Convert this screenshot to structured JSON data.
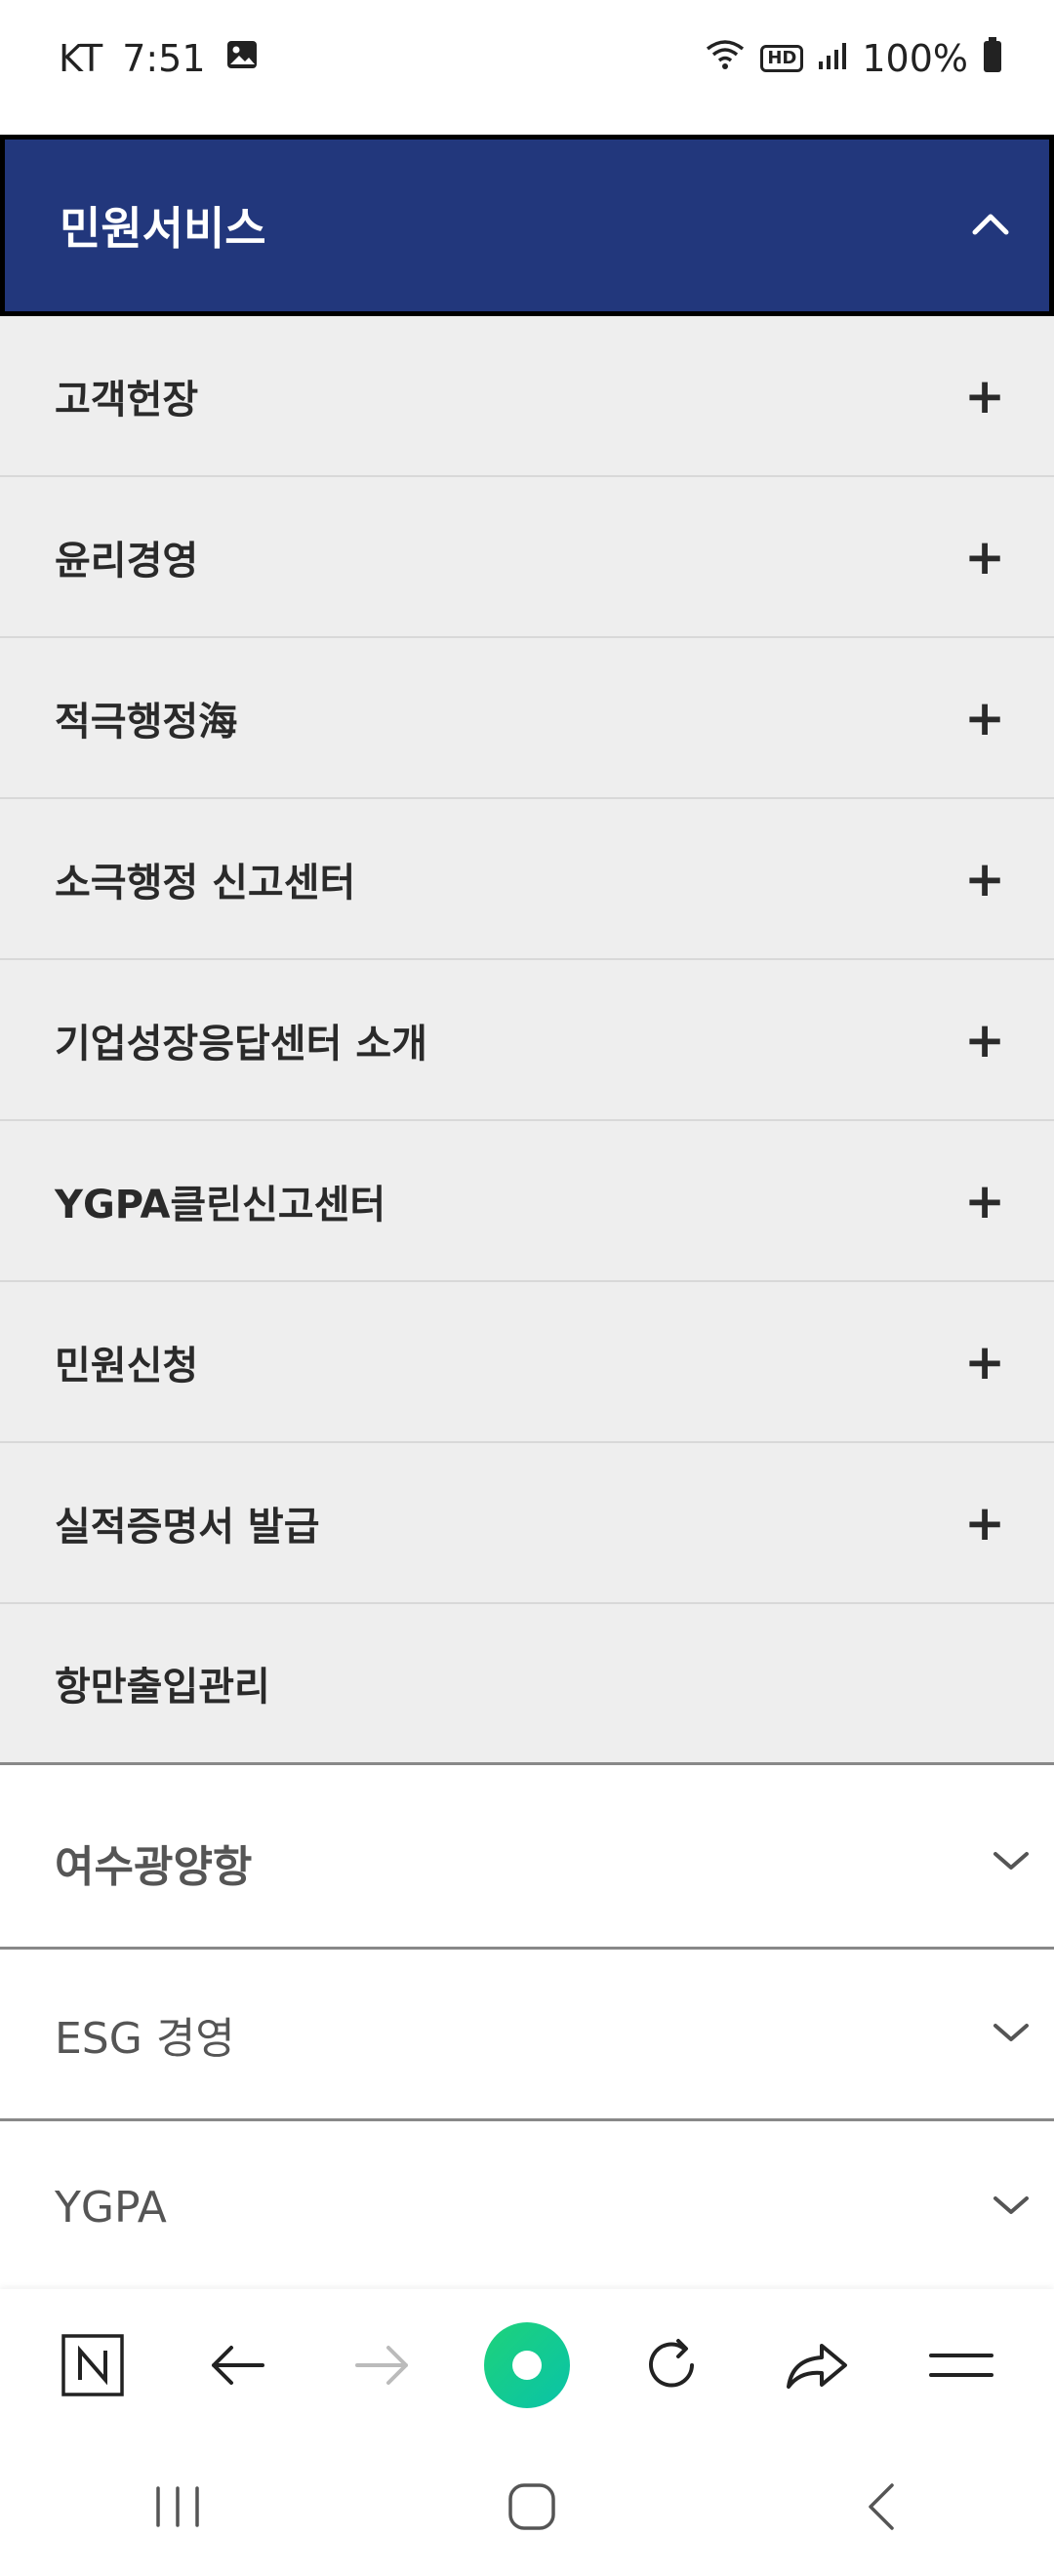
{
  "status_bar": {
    "carrier": "KT",
    "time": "7:51",
    "hd_badge": "HD",
    "battery": "100%"
  },
  "section": {
    "title": "민원서비스"
  },
  "menu_items": [
    {
      "label": "고객헌장"
    },
    {
      "label": "윤리경영"
    },
    {
      "label": "적극행정海"
    },
    {
      "label": "소극행정 신고센터"
    },
    {
      "label": "기업성장응답센터 소개"
    },
    {
      "label": "YGPA클린신고센터"
    },
    {
      "label": "민원신청"
    },
    {
      "label": "실적증명서 발급"
    },
    {
      "label": "항만출입관리"
    }
  ],
  "collapsed_sections": [
    {
      "label": "여수광양항"
    },
    {
      "label": "ESG 경영"
    },
    {
      "label": "YGPA"
    }
  ],
  "colors": {
    "header_bg": "#22377c",
    "item_bg": "#eeeeee",
    "accent_green": "#1ed27a"
  }
}
